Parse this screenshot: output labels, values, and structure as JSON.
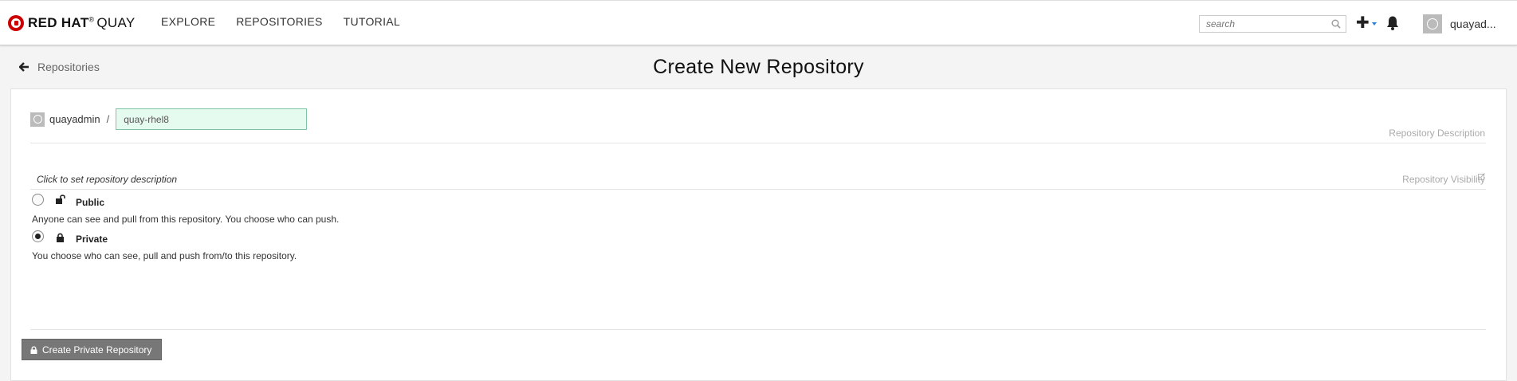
{
  "brand": {
    "name": "RED HAT",
    "mark": "®",
    "product": "QUAY"
  },
  "nav": {
    "links": [
      "EXPLORE",
      "REPOSITORIES",
      "TUTORIAL"
    ],
    "search_placeholder": "search",
    "user_name": "quayad..."
  },
  "header": {
    "back_label": "Repositories",
    "title": "Create New Repository"
  },
  "form": {
    "namespace": "quayadmin",
    "separator": "/",
    "repo_name": "quay-rhel8",
    "description_label": "Repository Description",
    "description_placeholder": "Click to set repository description",
    "visibility_label": "Repository Visibility",
    "visibility": {
      "public": {
        "title": "Public",
        "description": "Anyone can see and pull from this repository. You choose who can push.",
        "selected": false
      },
      "private": {
        "title": "Private",
        "description": "You choose who can see, pull and push from/to this repository.",
        "selected": true
      }
    },
    "submit_label": "Create Private Repository"
  },
  "colors": {
    "accent": "#2b7fd8",
    "brand_red": "#cc0000",
    "input_valid_bg": "#e6fbf0",
    "button_bg": "#777777"
  },
  "icons": {
    "logo": "red-hat-logo",
    "search": "search-icon",
    "add": "plus-icon",
    "notifications": "bell-icon",
    "back": "arrow-left-icon",
    "edit": "edit-icon",
    "public": "unlock-icon",
    "private": "lock-icon"
  }
}
